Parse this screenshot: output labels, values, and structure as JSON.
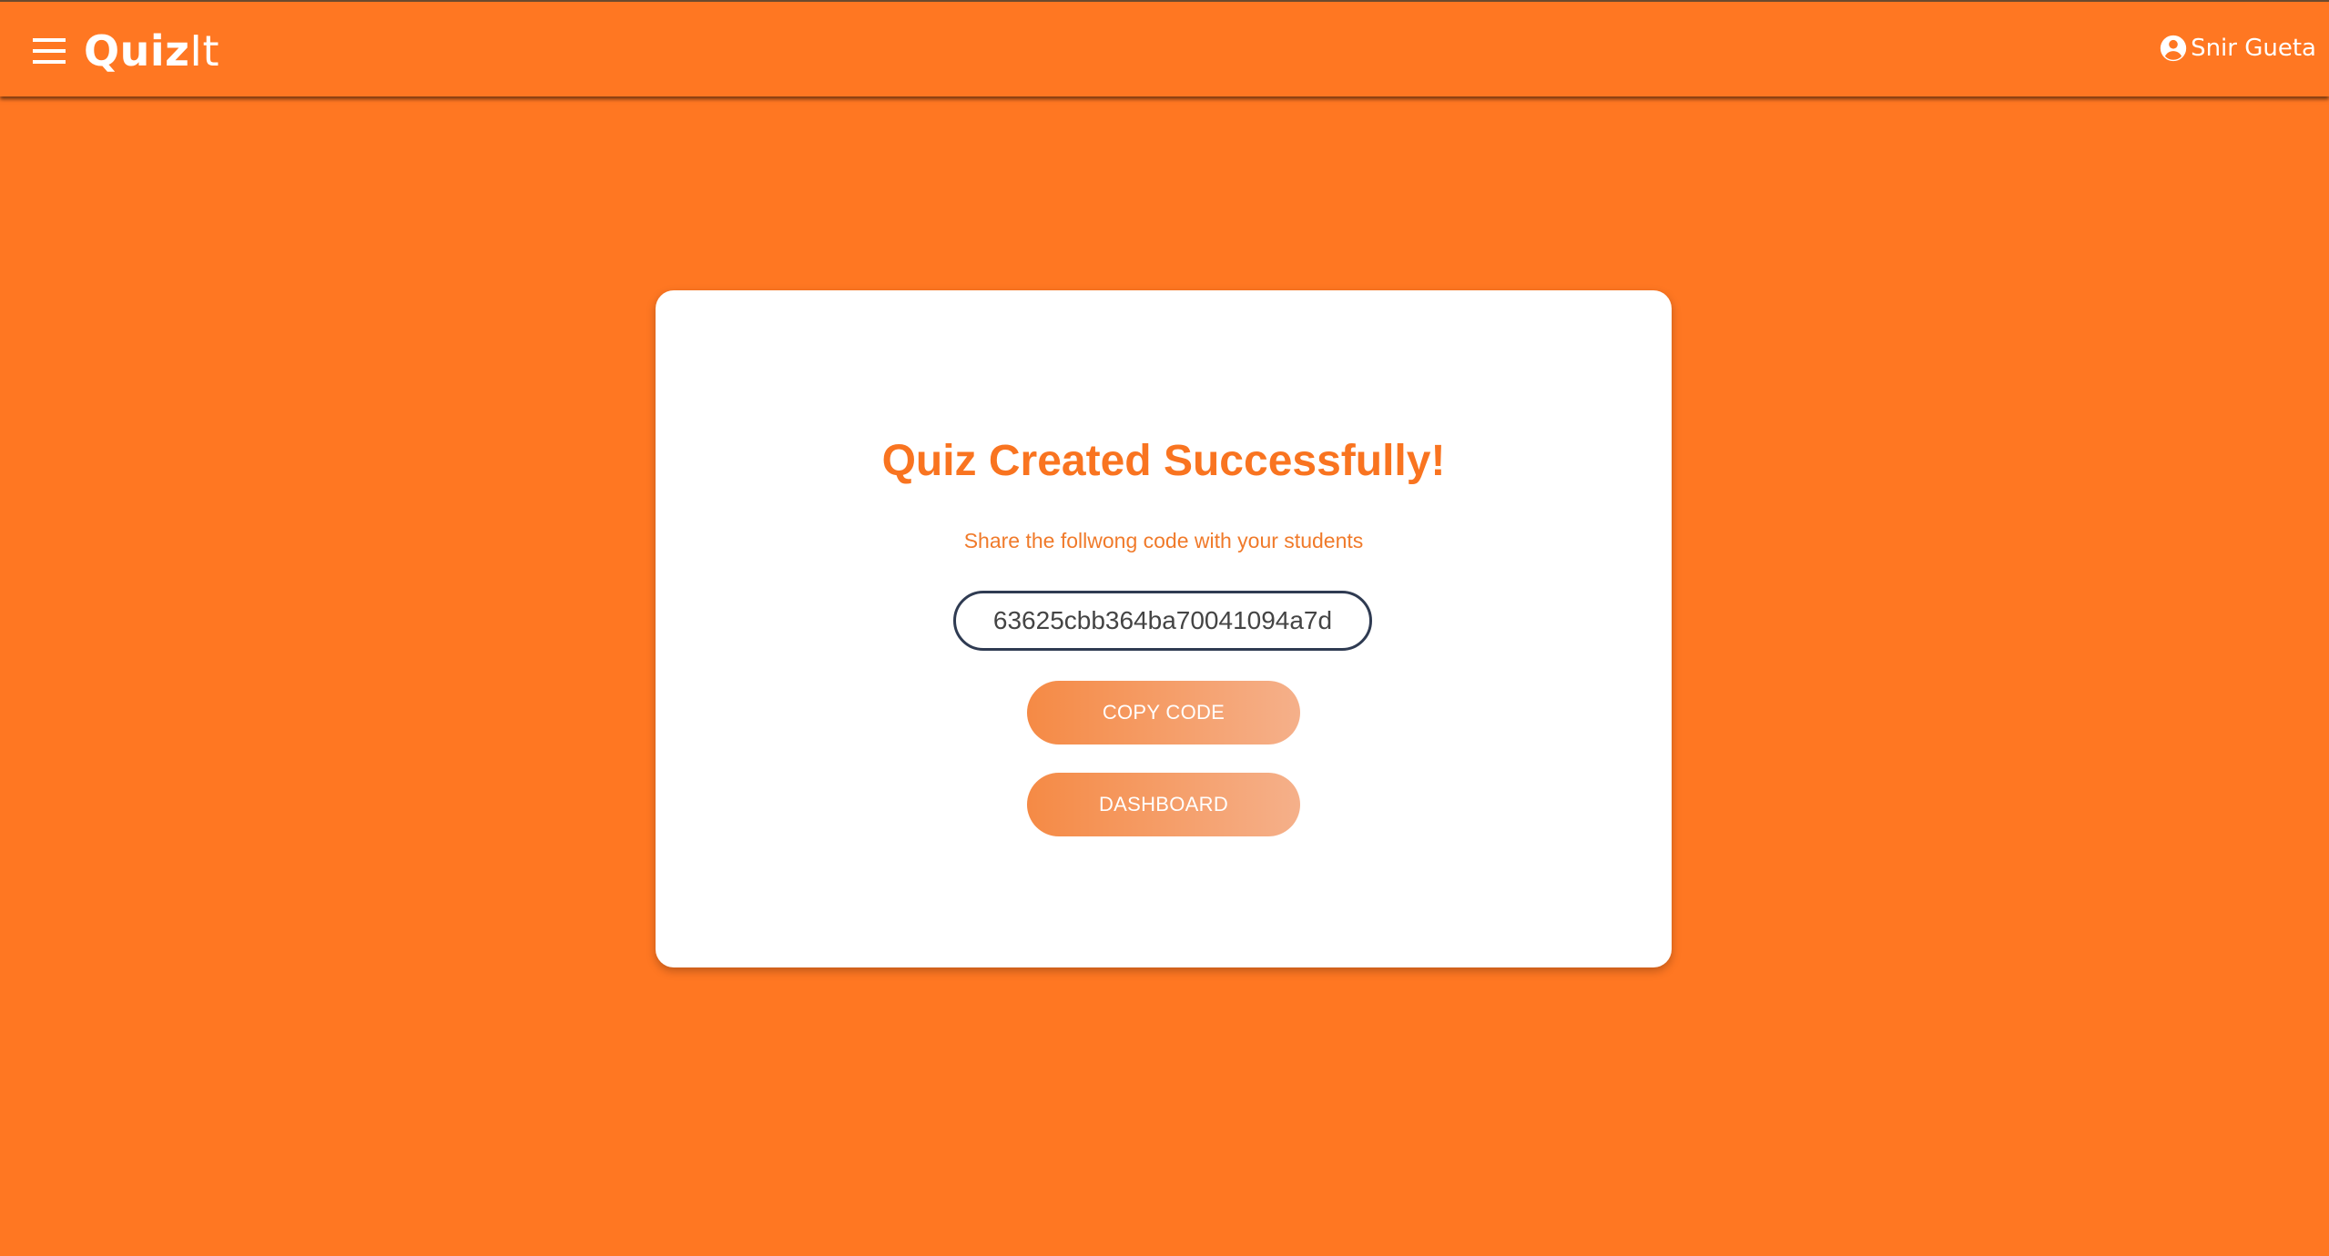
{
  "colors": {
    "background": "#ff7722",
    "accent": "#f97420",
    "card": "#ffffff",
    "code_border": "#2f3b52",
    "button_gradient_start": "#f58a45",
    "button_gradient_end": "#f5b08a"
  },
  "appbar": {
    "menu_icon": "hamburger-menu-icon",
    "brand_part1": "Quiz",
    "brand_part2": "It",
    "user_icon": "account-circle-icon",
    "user_name": "Snir Gueta"
  },
  "card": {
    "title": "Quiz Created Successfully!",
    "subtitle": "Share the follwong code with your students",
    "code": "63625cbb364ba70041094a7d",
    "copy_button_label": "COPY CODE",
    "dashboard_button_label": "DASHBOARD"
  }
}
